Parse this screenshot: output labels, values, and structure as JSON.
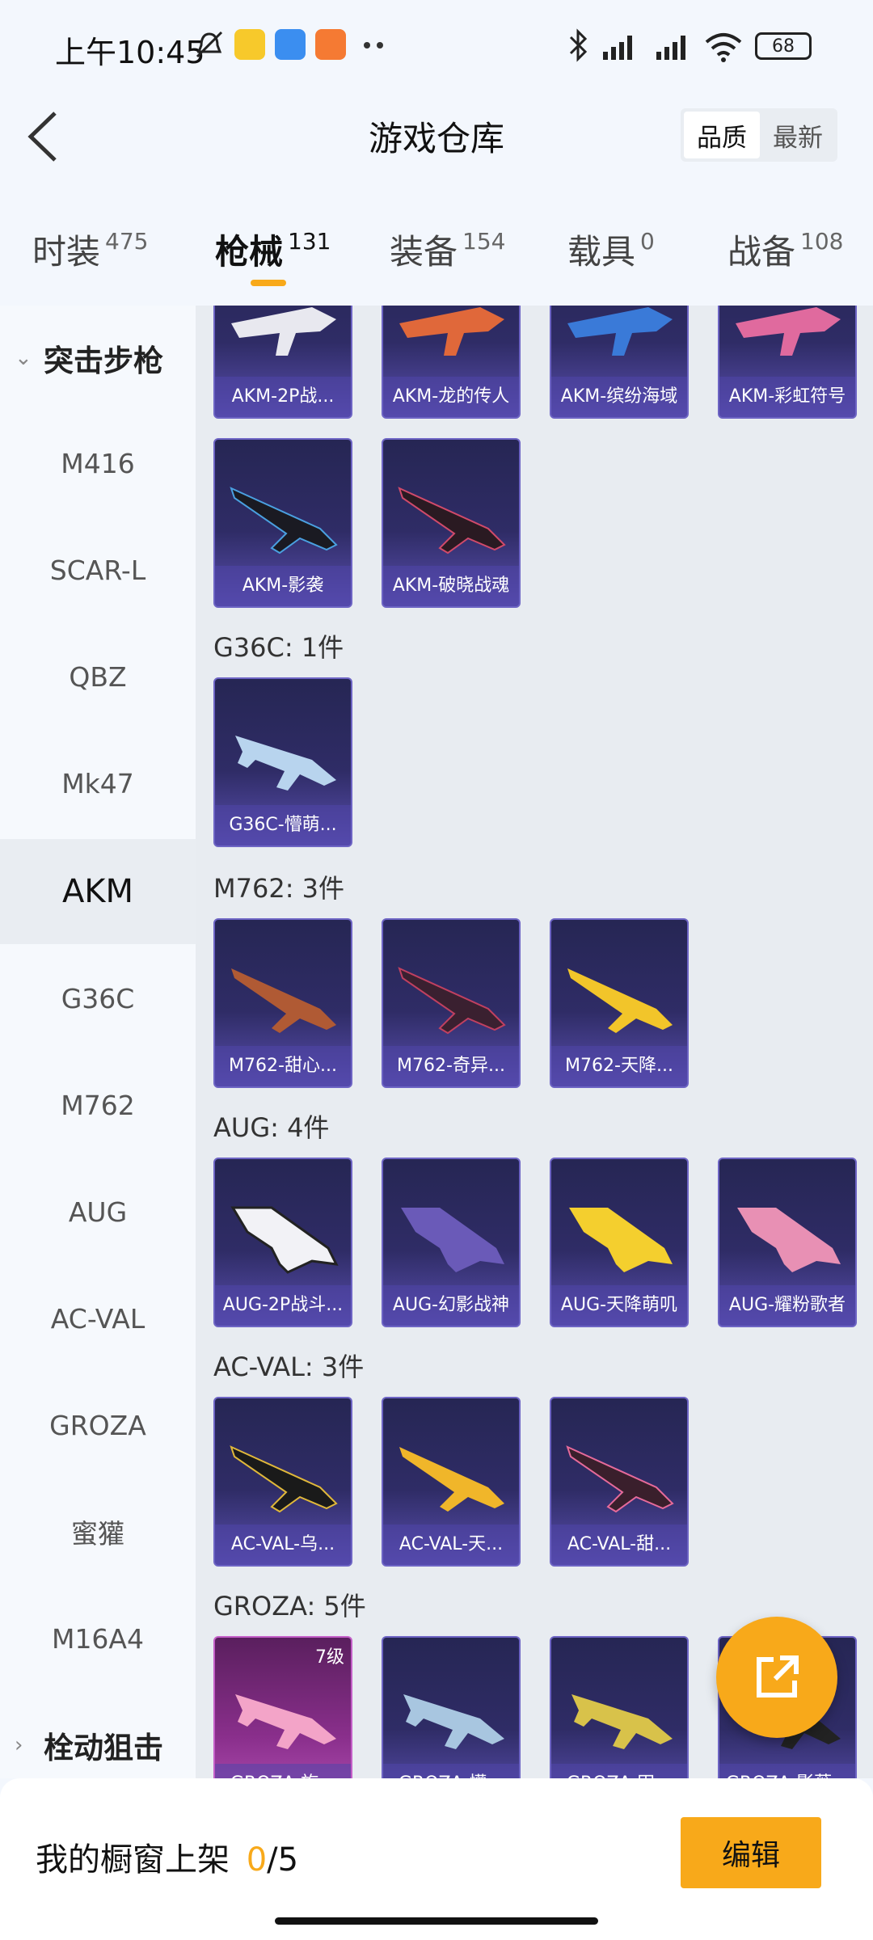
{
  "status_bar": {
    "time": "上午10:45",
    "battery": "68",
    "notif_icons": [
      "bell-off-icon",
      "app-icon-yellow",
      "app-icon-blue",
      "app-icon-orange",
      "more-dots-icon"
    ],
    "right_icons": [
      "bluetooth-icon",
      "signal-hd-icon",
      "signal-hd-icon",
      "wifi-icon",
      "battery-icon"
    ]
  },
  "header": {
    "title": "游戏仓库",
    "sort_options": [
      "品质",
      "最新"
    ],
    "sort_active": "品质"
  },
  "tabs": [
    {
      "label": "时装",
      "count": "475"
    },
    {
      "label": "枪械",
      "count": "131",
      "active": true
    },
    {
      "label": "装备",
      "count": "154"
    },
    {
      "label": "载具",
      "count": "0"
    },
    {
      "label": "战备",
      "count": "108"
    }
  ],
  "sidebar": {
    "category_top": "突击步枪",
    "items": [
      "M416",
      "SCAR-L",
      "QBZ",
      "Mk47",
      "AKM",
      "G36C",
      "M762",
      "AUG",
      "AC-VAL",
      "GROZA",
      "蜜獾",
      "M16A4"
    ],
    "active": "AKM",
    "category_bottom": "栓动狙击"
  },
  "content": {
    "akm_row1": [
      "AKM-2P战...",
      "AKM-龙的传人",
      "AKM-缤纷海域",
      "AKM-彩虹符号"
    ],
    "akm_row2": [
      "AKM-影袭",
      "AKM-破晓战魂"
    ],
    "sections": [
      {
        "title": "G36C: 1件",
        "items": [
          "G36C-懵萌..."
        ]
      },
      {
        "title": "M762: 3件",
        "items": [
          "M762-甜心...",
          "M762-奇异...",
          "M762-天降..."
        ]
      },
      {
        "title": "AUG: 4件",
        "items": [
          "AUG-2P战斗...",
          "AUG-幻影战神",
          "AUG-天降萌叽",
          "AUG-耀粉歌者"
        ]
      },
      {
        "title": "AC-VAL: 3件",
        "items": [
          "AC-VAL-乌...",
          "AC-VAL-天...",
          "AC-VAL-甜..."
        ]
      },
      {
        "title": "GROZA: 5件",
        "items": [
          "GROZA-旋...",
          "GROZA-懵...",
          "GROZA-田...",
          "GROZA-影薇..."
        ]
      }
    ],
    "groza_level": "7级"
  },
  "footer": {
    "showcase_label": "我的橱窗上架",
    "showcase_count": "0",
    "showcase_total": "/5",
    "edit_label": "编辑"
  },
  "colors": {
    "accent": "#f8a91a",
    "card_bg": "#2f2c66",
    "card_border": "#6d64c4",
    "tab_underline": "#f8a91a"
  }
}
